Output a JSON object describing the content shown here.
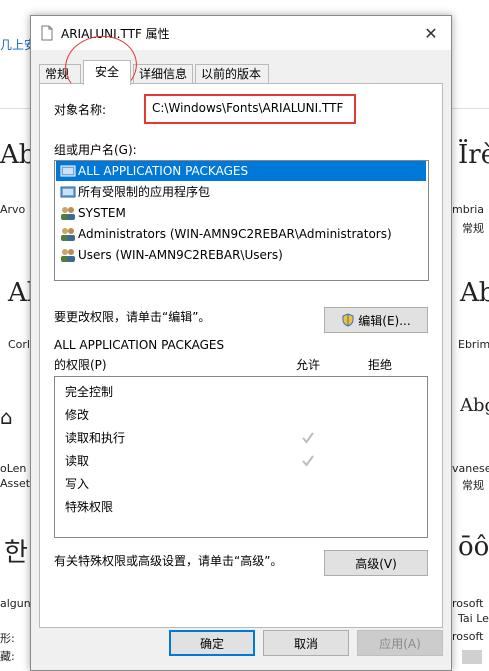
{
  "background": {
    "top_link": "几上安",
    "left_labels": [
      "Arvo",
      "Corl",
      "oLen",
      "Assets",
      "algun",
      "形:",
      "藏:"
    ],
    "left_glyphs": [
      "Ab",
      "Ab",
      "한"
    ],
    "right_glyphs": [
      "Ïrè",
      "Ab",
      "Abg",
      "ōôc"
    ],
    "right_labels": [
      "mbria",
      "常规",
      "Ebrim",
      "vanese",
      "常规",
      "rosoft",
      "Tai Le",
      "rosoft"
    ]
  },
  "dialog": {
    "title": "ARIALUNI.TTF 属性",
    "close_glyph": "✕",
    "tabs": [
      "常规",
      "安全",
      "详细信息",
      "以前的版本"
    ],
    "object_name_label": "对象名称:",
    "object_name_value": "C:\\Windows\\Fonts\\ARIALUNI.TTF",
    "group_label": "组或用户名(G):",
    "users": [
      {
        "name": "ALL APPLICATION PACKAGES",
        "icon": "package-icon",
        "selected": true
      },
      {
        "name": "所有受限制的应用程序包",
        "icon": "package-icon",
        "selected": false
      },
      {
        "name": "SYSTEM",
        "icon": "user-group-icon",
        "selected": false
      },
      {
        "name": "Administrators (WIN-AMN9C2REBAR\\Administrators)",
        "icon": "user-group-icon",
        "selected": false
      },
      {
        "name": "Users (WIN-AMN9C2REBAR\\Users)",
        "icon": "user-group-icon",
        "selected": false
      }
    ],
    "change_perm_text": "要更改权限，请单击“编辑”。",
    "edit_button": "编辑(E)...",
    "perm_for_line1": "ALL APPLICATION PACKAGES",
    "perm_for_line2": "的权限(P)",
    "allow_header": "允许",
    "deny_header": "拒绝",
    "permissions": [
      {
        "name": "完全控制",
        "allow": false
      },
      {
        "name": "修改",
        "allow": false
      },
      {
        "name": "读取和执行",
        "allow": true
      },
      {
        "name": "读取",
        "allow": true
      },
      {
        "name": "写入",
        "allow": false
      },
      {
        "name": "特殊权限",
        "allow": false
      }
    ],
    "advanced_text": "有关特殊权限或高级设置，请单击“高级”。",
    "advanced_button": "高级(V)",
    "ok_button": "确定",
    "cancel_button": "取消",
    "apply_button": "应用(A)",
    "colors": {
      "accent": "#0078d7",
      "highlight_red": "#e53935"
    }
  }
}
